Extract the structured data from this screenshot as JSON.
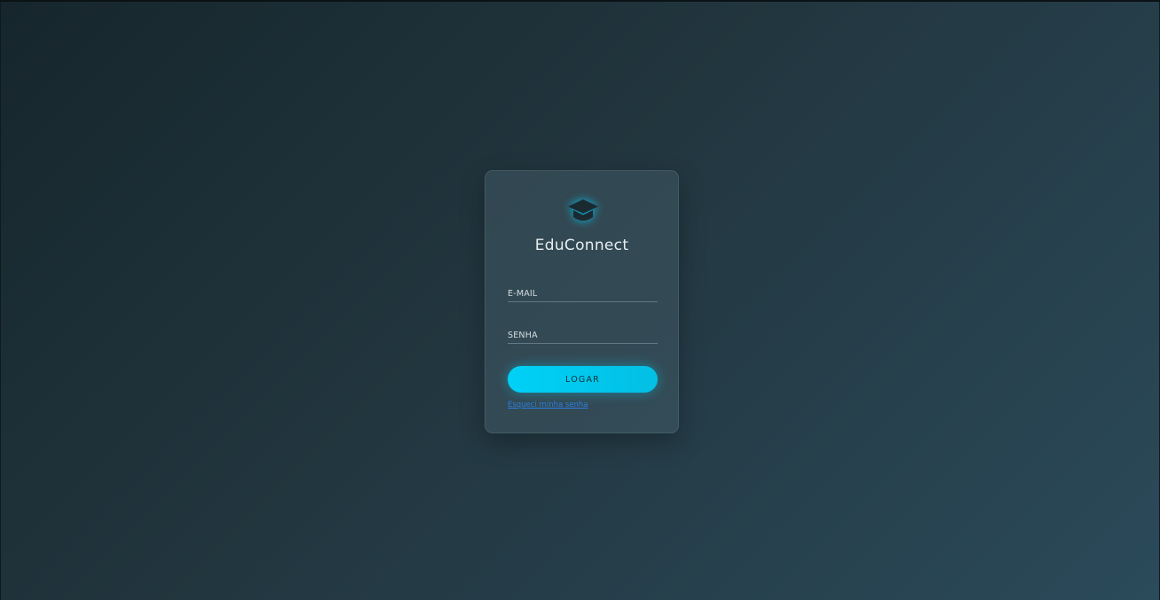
{
  "app": {
    "title": "EduConnect",
    "logo_icon": "graduation-cap-icon"
  },
  "form": {
    "email": {
      "placeholder": "E-MAIL",
      "value": ""
    },
    "password": {
      "placeholder": "SENHA",
      "value": ""
    },
    "submit_label": "LOGAR",
    "forgot_password_label": "Esqueci minha senha"
  },
  "colors": {
    "accent": "#00d1f7",
    "link": "#2b7fe0",
    "logo": "#1b2a30",
    "logo_glow": "#00d0ff"
  }
}
